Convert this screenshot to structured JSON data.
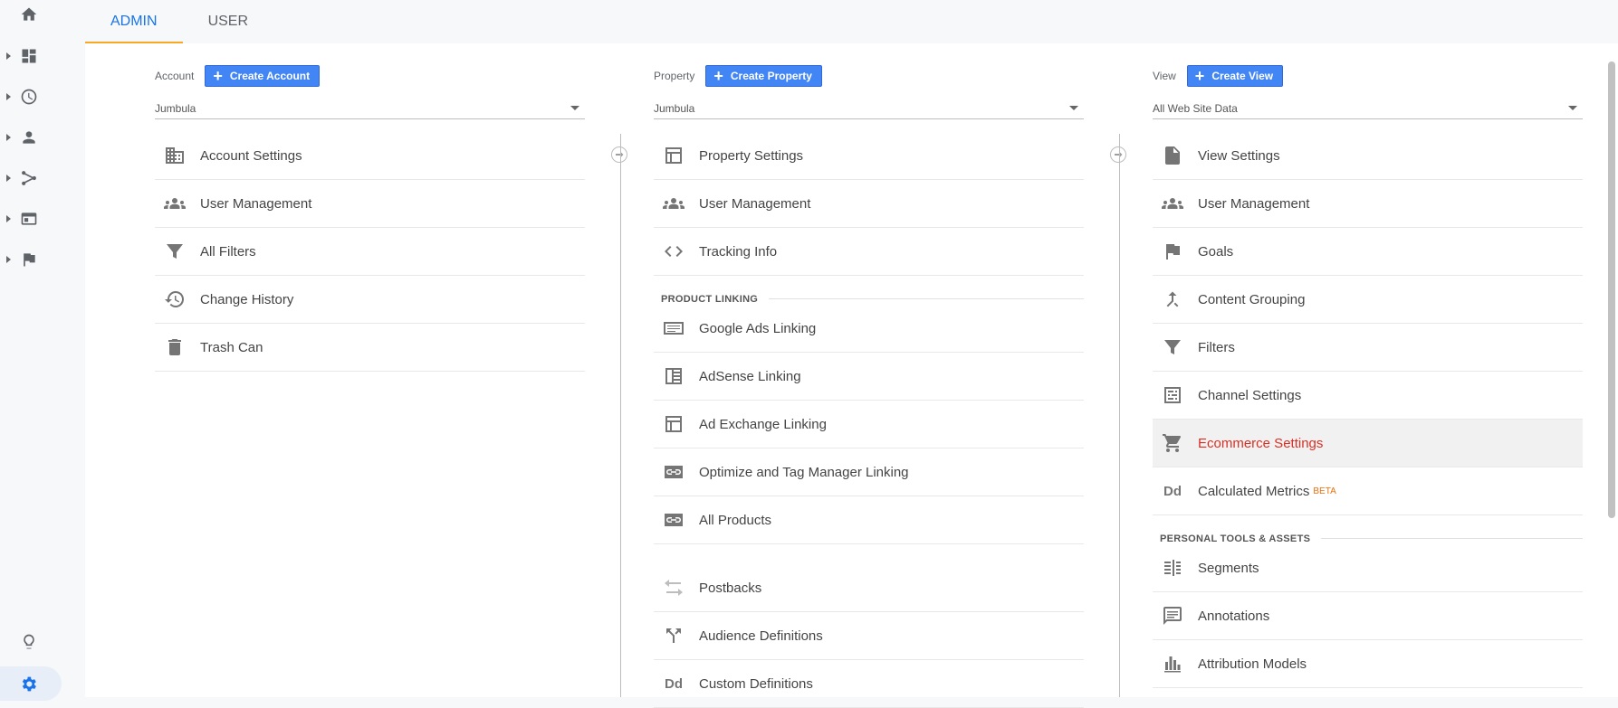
{
  "tabs": [
    {
      "label": "ADMIN"
    },
    {
      "label": "USER"
    }
  ],
  "account": {
    "label": "Account",
    "create": "Create Account",
    "selected": "Jumbula",
    "items": [
      {
        "label": "Account Settings",
        "icon": "building-icon"
      },
      {
        "label": "User Management",
        "icon": "people-icon"
      },
      {
        "label": "All Filters",
        "icon": "filter-icon"
      },
      {
        "label": "Change History",
        "icon": "history-icon"
      },
      {
        "label": "Trash Can",
        "icon": "trash-icon"
      }
    ]
  },
  "property": {
    "label": "Property",
    "create": "Create Property",
    "selected": "Jumbula",
    "items": [
      {
        "label": "Property Settings",
        "icon": "layout-icon"
      },
      {
        "label": "User Management",
        "icon": "people-icon"
      },
      {
        "label": "Tracking Info",
        "icon": "code-icon"
      }
    ],
    "linking_header": "PRODUCT LINKING",
    "linking": [
      {
        "label": "Google Ads Linking",
        "icon": "ads-icon"
      },
      {
        "label": "AdSense Linking",
        "icon": "adsense-icon"
      },
      {
        "label": "Ad Exchange Linking",
        "icon": "layout-icon"
      },
      {
        "label": "Optimize and Tag Manager Linking",
        "icon": "link-icon"
      },
      {
        "label": "All Products",
        "icon": "link-icon"
      }
    ],
    "more": [
      {
        "label": "Postbacks",
        "icon": "postback-icon"
      },
      {
        "label": "Audience Definitions",
        "icon": "fork-icon"
      },
      {
        "label": "Custom Definitions",
        "icon": "dd-icon"
      }
    ]
  },
  "view": {
    "label": "View",
    "create": "Create View",
    "selected": "All Web Site Data",
    "items": [
      {
        "label": "View Settings",
        "icon": "document-icon"
      },
      {
        "label": "User Management",
        "icon": "people-icon"
      },
      {
        "label": "Goals",
        "icon": "flag-icon"
      },
      {
        "label": "Content Grouping",
        "icon": "merge-icon"
      },
      {
        "label": "Filters",
        "icon": "filter-icon"
      },
      {
        "label": "Channel Settings",
        "icon": "channel-icon"
      },
      {
        "label": "Ecommerce Settings",
        "icon": "cart-icon"
      },
      {
        "label": "Calculated Metrics",
        "icon": "dd-icon",
        "badge": "BETA"
      }
    ],
    "tools_header": "PERSONAL TOOLS & ASSETS",
    "tools": [
      {
        "label": "Segments",
        "icon": "segments-icon"
      },
      {
        "label": "Annotations",
        "icon": "comment-icon"
      },
      {
        "label": "Attribution Models",
        "icon": "bars-icon"
      }
    ]
  },
  "colors": {
    "accent": "#1a73e8",
    "highlight": "#d93025",
    "tab_underline": "#f9a825",
    "button": "#4285f4"
  }
}
